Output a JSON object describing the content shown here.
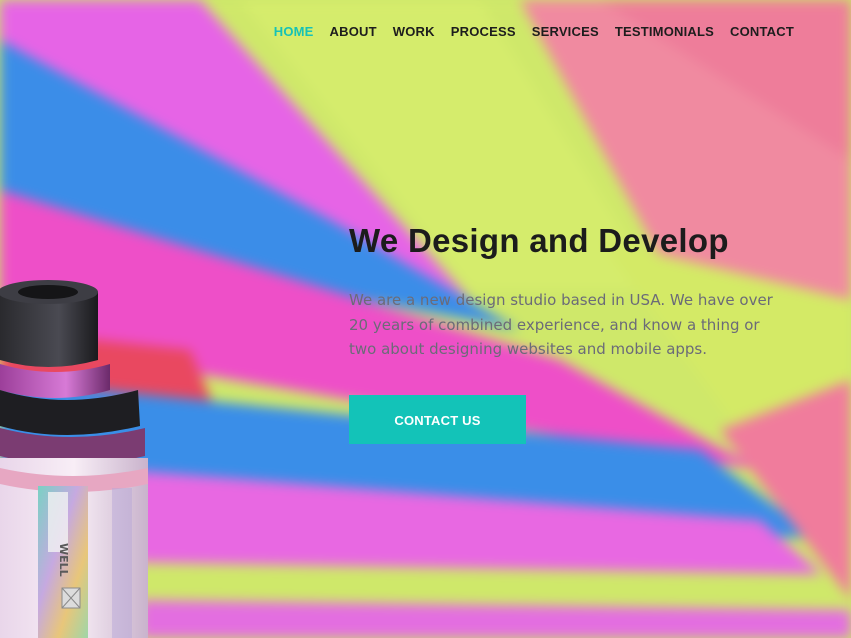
{
  "nav": {
    "items": [
      {
        "label": "HOME",
        "active": true
      },
      {
        "label": "ABOUT",
        "active": false
      },
      {
        "label": "WORK",
        "active": false
      },
      {
        "label": "PROCESS",
        "active": false
      },
      {
        "label": "SERVICES",
        "active": false
      },
      {
        "label": "TESTIMONIALS",
        "active": false
      },
      {
        "label": "CONTACT",
        "active": false
      }
    ]
  },
  "hero": {
    "title": "We Design and Develop",
    "description": "We are a new design studio based in USA. We have over 20 years of combined experience, and know a thing or two about designing websites and mobile apps.",
    "cta_label": "CONTACT US"
  },
  "device": {
    "engraving": "WELL"
  },
  "colors": {
    "accent": "#13c3b8",
    "nav_text": "#1d1d1d",
    "body_text": "#6b6b78"
  }
}
